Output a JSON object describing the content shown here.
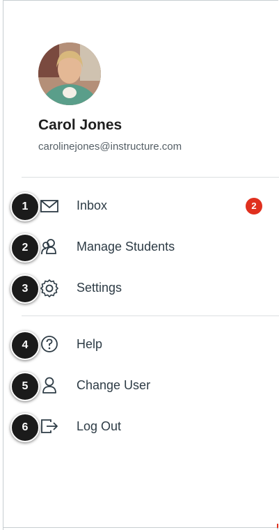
{
  "profile": {
    "name": "Carol Jones",
    "email": "carolinejones@instructure.com"
  },
  "menu_primary": [
    {
      "label": "Inbox",
      "icon": "envelope-icon",
      "badge": "2",
      "callout": "1"
    },
    {
      "label": "Manage Students",
      "icon": "students-icon",
      "callout": "2"
    },
    {
      "label": "Settings",
      "icon": "gear-icon",
      "callout": "3"
    }
  ],
  "menu_secondary": [
    {
      "label": "Help",
      "icon": "help-icon",
      "callout": "4"
    },
    {
      "label": "Change User",
      "icon": "user-icon",
      "callout": "5"
    },
    {
      "label": "Log Out",
      "icon": "logout-icon",
      "callout": "6"
    }
  ],
  "colors": {
    "badge": "#e0301e",
    "text": "#2d3b45",
    "callout": "#1b1b1b"
  }
}
